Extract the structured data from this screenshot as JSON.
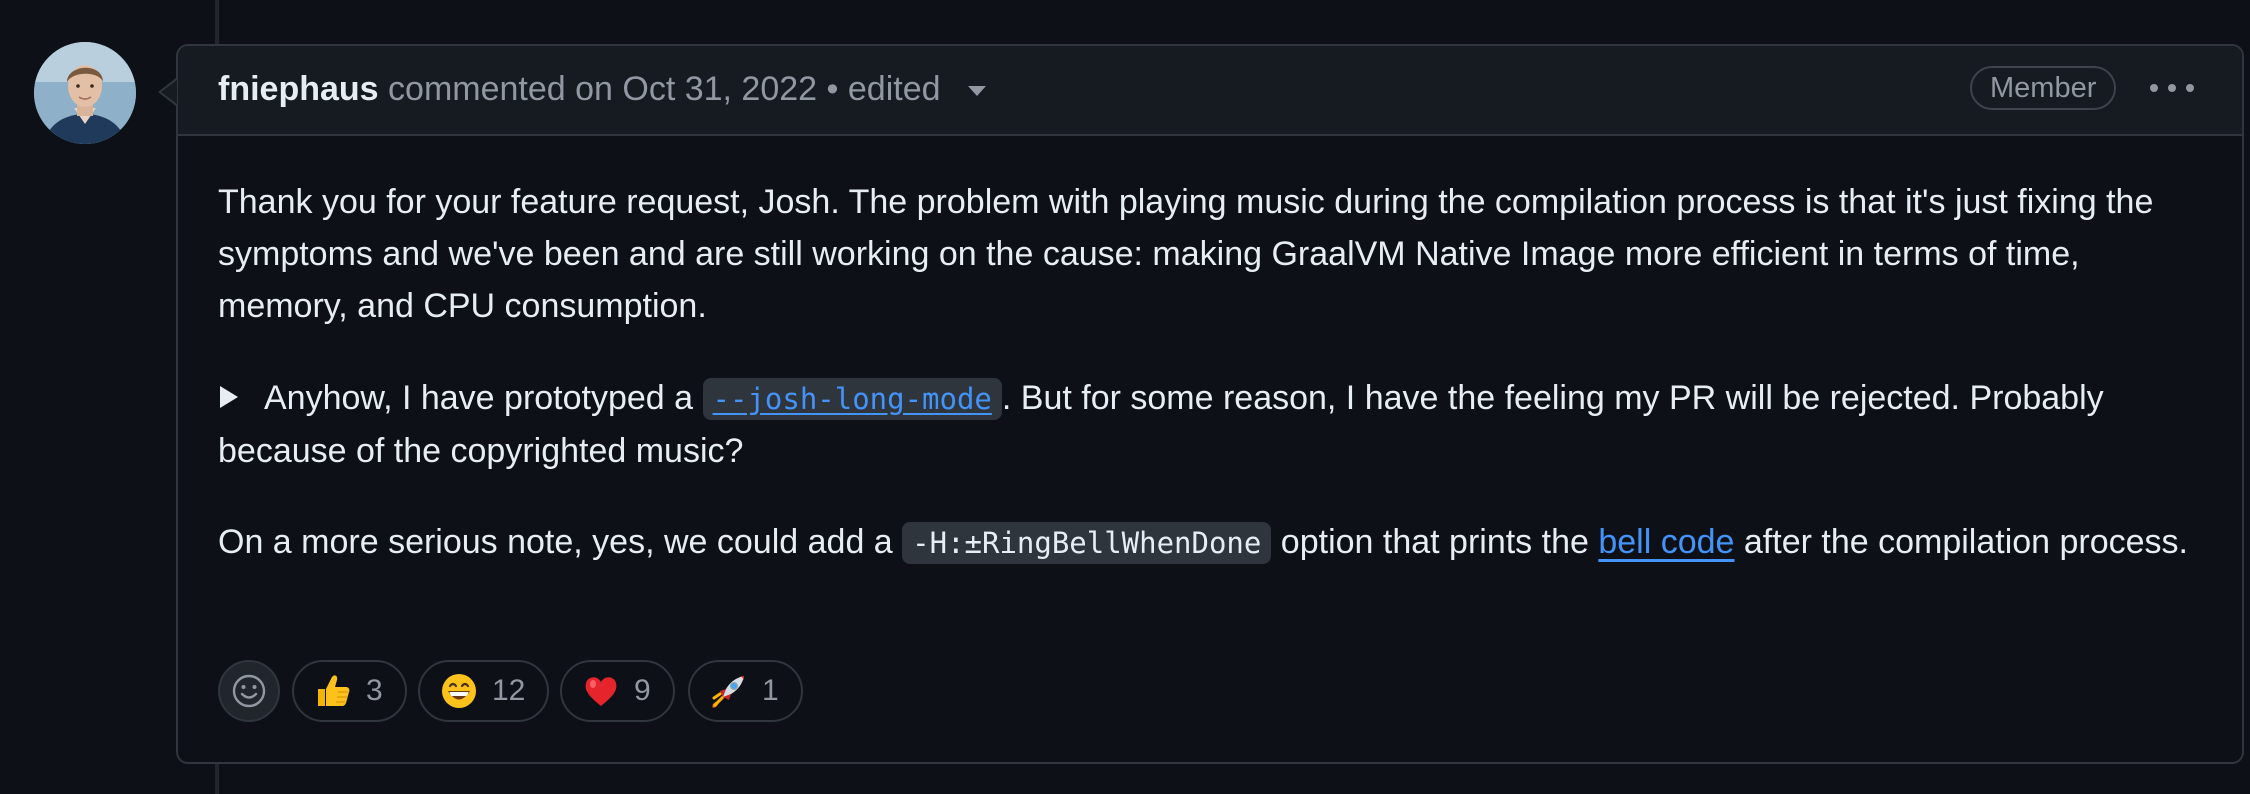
{
  "comment": {
    "author": "fniephaus",
    "action": "commented on Oct 31, 2022",
    "edited_label": "• edited",
    "role_badge": "Member",
    "paragraphs": {
      "p1": "Thank you for your feature request, Josh. The problem with playing music during the compilation process is that it's just fixing the symptoms and we've been and are still working on the cause: making GraalVM Native Image more efficient in terms of time, memory, and CPU consumption.",
      "p2_before": "Anyhow, I have prototyped a ",
      "p2_code_link": "--josh-long-mode",
      "p2_after": ". But for some reason, I have the feeling my PR will be rejected. Probably because of the copyrighted music?",
      "p3_before": "On a more serious note, yes, we could add a ",
      "p3_code": "-H:±RingBellWhenDone",
      "p3_middle": " option that prints the ",
      "p3_link": "bell code",
      "p3_after": " after the compilation process."
    },
    "reactions": [
      {
        "icon": "thumbs-up-icon",
        "count": "3"
      },
      {
        "icon": "grinning-face-icon",
        "count": "12"
      },
      {
        "icon": "red-heart-icon",
        "count": "9"
      },
      {
        "icon": "rocket-icon",
        "count": "1"
      }
    ]
  },
  "colors": {
    "background": "#0d1117",
    "header_bg": "#161b22",
    "border": "#30363d",
    "text": "#e6edf3",
    "muted": "#9198a1",
    "link": "#4493f8"
  }
}
